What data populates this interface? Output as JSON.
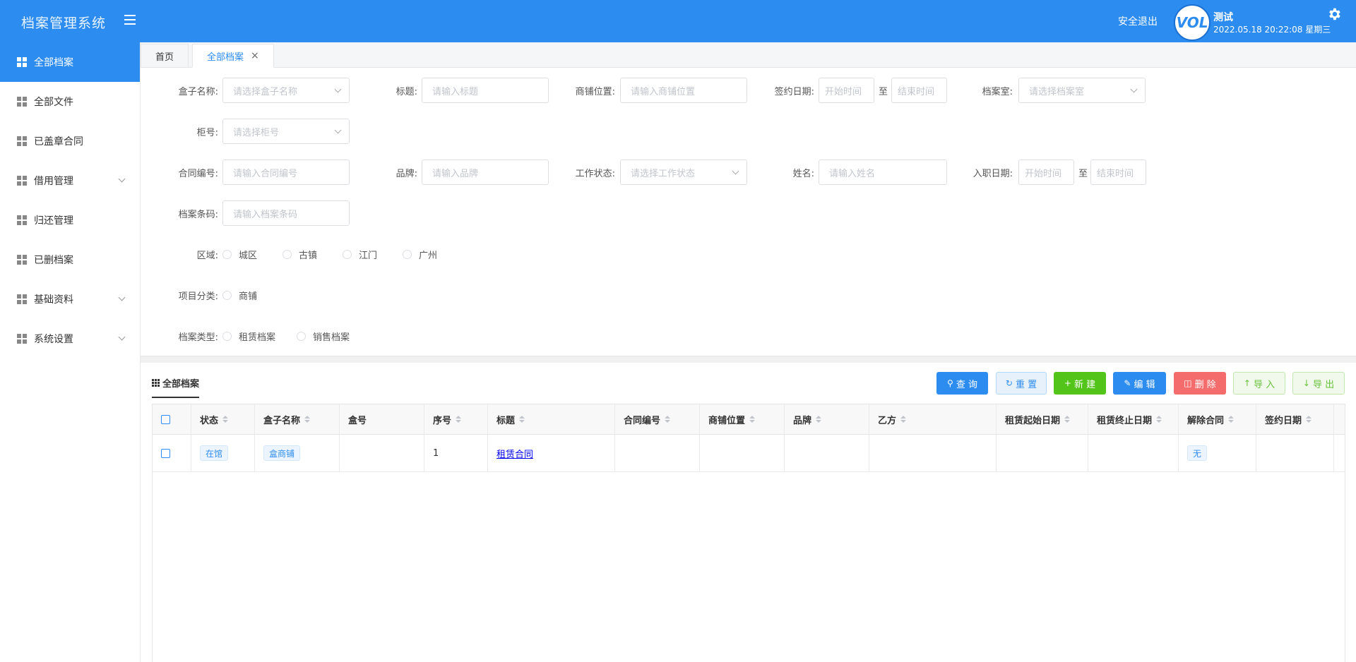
{
  "header": {
    "app_title": "档案管理系统",
    "logout": "安全退出",
    "avatar_text": "VOL",
    "user_name": "测试",
    "datetime": "2022.05.18 20:22:08 星期三"
  },
  "sidebar": {
    "items": [
      {
        "label": "全部档案",
        "active": true
      },
      {
        "label": "全部文件"
      },
      {
        "label": "已盖章合同"
      },
      {
        "label": "借用管理",
        "has_children": true
      },
      {
        "label": "归还管理"
      },
      {
        "label": "已删档案"
      },
      {
        "label": "基础资料",
        "has_children": true
      },
      {
        "label": "系统设置",
        "has_children": true
      }
    ]
  },
  "tabs": {
    "home": "首页",
    "current": "全部档案",
    "close": "×"
  },
  "filters": {
    "box_name": {
      "label": "盒子名称:",
      "placeholder": "请选择盒子名称"
    },
    "title": {
      "label": "标题:",
      "placeholder": "请输入标题"
    },
    "shop_location": {
      "label": "商铺位置:",
      "placeholder": "请输入商铺位置"
    },
    "sign_date": {
      "label": "签约日期:",
      "start": "开始时间",
      "end": "结束时间",
      "sep": "至"
    },
    "archive_room": {
      "label": "档案室:",
      "placeholder": "请选择档案室"
    },
    "cabinet_no": {
      "label": "柜号:",
      "placeholder": "请选择柜号"
    },
    "contract_no": {
      "label": "合同编号:",
      "placeholder": "请输入合同编号"
    },
    "brand": {
      "label": "品牌:",
      "placeholder": "请输入品牌"
    },
    "work_status": {
      "label": "工作状态:",
      "placeholder": "请选择工作状态"
    },
    "name": {
      "label": "姓名:",
      "placeholder": "请输入姓名"
    },
    "hire_date": {
      "label": "入职日期:",
      "start": "开始时间",
      "end": "结束时间",
      "sep": "至"
    },
    "barcode": {
      "label": "档案条码:",
      "placeholder": "请输入档案条码"
    },
    "region": {
      "label": "区域:",
      "options": [
        "城区",
        "古镇",
        "江门",
        "广州"
      ]
    },
    "project_type": {
      "label": "项目分类:",
      "options": [
        "商铺"
      ]
    },
    "archive_type": {
      "label": "档案类型:",
      "options": [
        "租赁档案",
        "销售档案"
      ]
    }
  },
  "grid": {
    "title": "全部档案",
    "buttons": {
      "query": "查 询",
      "reset": "重 置",
      "new": "新 建",
      "edit": "编 辑",
      "delete": "删 除",
      "import": "导 入",
      "export": "导 出"
    },
    "columns": [
      "状态",
      "盒子名称",
      "盒号",
      "序号",
      "标题",
      "合同编号",
      "商铺位置",
      "品牌",
      "乙方",
      "租赁起始日期",
      "租赁终止日期",
      "解除合同",
      "签约日期"
    ],
    "rows": [
      {
        "status": "在馆",
        "box_name": "盒商铺",
        "box_no": "",
        "seq": "1",
        "title": "租赁合同",
        "contract_no": "",
        "shop_location": "",
        "brand": "",
        "party_b": "",
        "lease_start": "",
        "lease_end": "",
        "terminate": "无",
        "sign_date": ""
      }
    ]
  },
  "colors": {
    "primary": "#2d8cf0",
    "new_button": "#52c41a",
    "delete_button": "#f56c6c",
    "reset_button_bg": "#e6f1fc"
  }
}
